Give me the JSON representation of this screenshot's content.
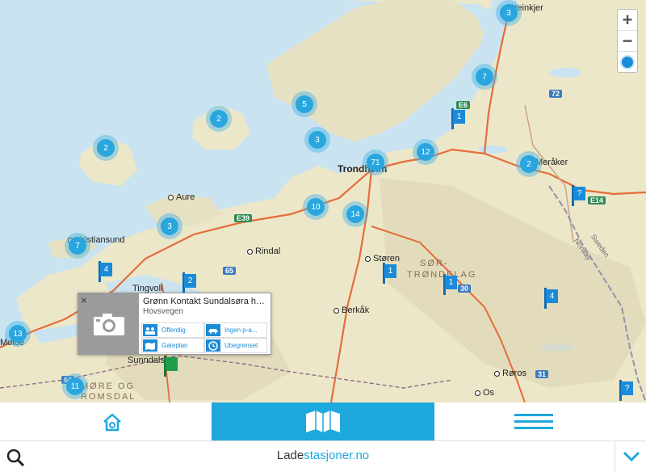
{
  "map": {
    "places": [
      {
        "name": "Steinkjer",
        "big": false
      },
      {
        "name": "Trondheim",
        "big": true
      },
      {
        "name": "Meråker",
        "big": false
      },
      {
        "name": "Aure",
        "big": false
      },
      {
        "name": "Kristiansund",
        "big": false
      },
      {
        "name": "Rindal",
        "big": false
      },
      {
        "name": "Tingvoll",
        "big": false
      },
      {
        "name": "Støren",
        "big": false
      },
      {
        "name": "Berkåk",
        "big": false
      },
      {
        "name": "Sunndalsøra",
        "big": false
      },
      {
        "name": "Røros",
        "big": false
      },
      {
        "name": "Os",
        "big": false
      },
      {
        "name": "Molde",
        "big": false
      }
    ],
    "regions": [
      "SØR-",
      "TRØNDELAG",
      "MØRE OG",
      "ROMSDAL"
    ],
    "border_labels": [
      "Sweden",
      "Norway"
    ],
    "road_badges": [
      "E39",
      "E6",
      "E14",
      "65",
      "72",
      "30",
      "31",
      "64"
    ],
    "clusters": [
      "3",
      "7",
      "5",
      "2",
      "2",
      "3",
      "71",
      "12",
      "2",
      "10",
      "14",
      "3",
      "7",
      "13",
      "11"
    ],
    "flags": [
      "1",
      "?",
      "4",
      "2",
      "1",
      "1",
      "4",
      "?"
    ],
    "green_flag": ""
  },
  "zoom": {
    "in": "+",
    "out": "−"
  },
  "popup": {
    "close": "×",
    "title": "Grønn Kontakt Sundalsøra hu...",
    "subtitle": "Hovsvegen",
    "attrs": [
      "Offentlig",
      "Ingen p-a...",
      "Gateplan",
      "Ubegrenset"
    ]
  },
  "search": {
    "logo_part1": "Lade",
    "logo_part2": "stasjoner.no"
  },
  "colors": {
    "accent": "#1fa8dc",
    "cluster": "#2aa6df",
    "flag": "#1a8bd8",
    "sea": "#c9e3f0",
    "land": "#ece7c9"
  }
}
